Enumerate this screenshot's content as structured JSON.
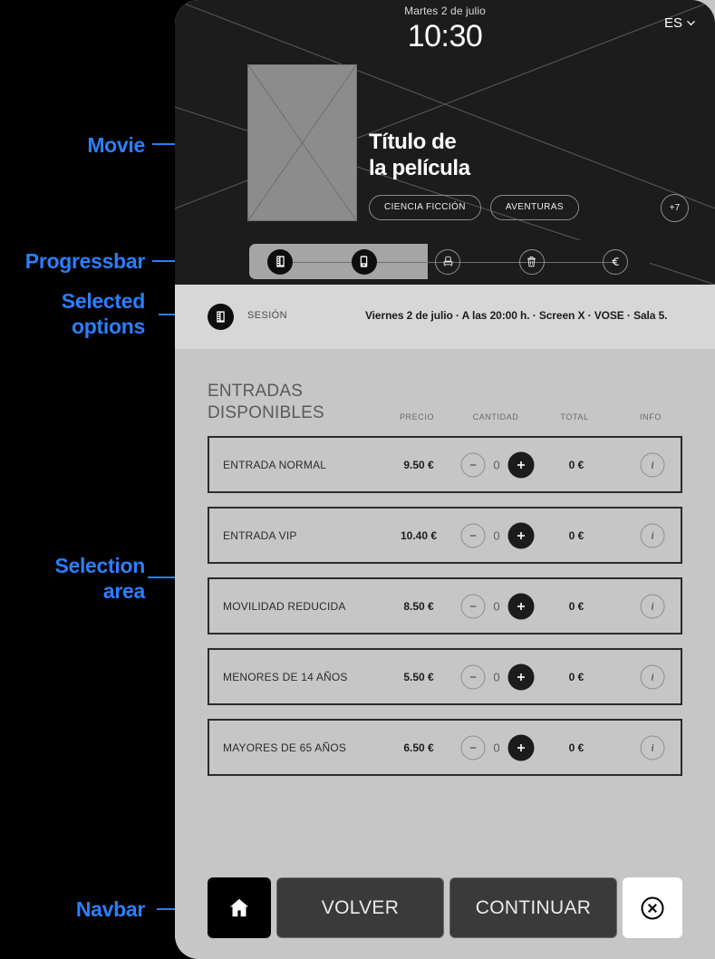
{
  "annotations": [
    {
      "id": "movie",
      "label": "Movie"
    },
    {
      "id": "progressbar",
      "label": "Progressbar"
    },
    {
      "id": "selected-options",
      "label": "Selected\noptions"
    },
    {
      "id": "selection-area",
      "label": "Selection\narea"
    },
    {
      "id": "navbar",
      "label": "Navbar"
    }
  ],
  "accent_color": "#2b7fff",
  "header": {
    "date": "Martes 2 de julio",
    "time": "10:30",
    "language": "ES",
    "language_chevron_icon": "chevron-down-icon"
  },
  "movie": {
    "poster_icon": "placeholder-image-icon",
    "title": "Título de\nla película",
    "tags": [
      "CIENCIA FICCIÓN",
      "AVENTURAS"
    ],
    "more_tags_badge": "+7"
  },
  "progressbar": {
    "fill_percent": 45,
    "steps": [
      {
        "icon": "film-strip-icon",
        "state": "done"
      },
      {
        "icon": "ticket-icon",
        "state": "done"
      },
      {
        "icon": "seat-icon",
        "state": "todo"
      },
      {
        "icon": "popcorn-icon",
        "state": "todo"
      },
      {
        "icon": "euro-icon",
        "state": "todo"
      }
    ]
  },
  "session": {
    "icon": "film-strip-icon",
    "label": "SESIÓN",
    "value": "Viernes 2 de julio · A las 20:00 h. · Screen X · VOSE · Sala 5."
  },
  "selection": {
    "title": "ENTRADAS\nDISPONIBLES",
    "columns": [
      "PRECIO",
      "CANTIDAD",
      "TOTAL",
      "INFO"
    ],
    "rows": [
      {
        "name": "ENTRADA NORMAL",
        "price": "9.50 €",
        "qty": "0",
        "total": "0 €",
        "info_icon": "info-icon"
      },
      {
        "name": "ENTRADA VIP",
        "price": "10.40 €",
        "qty": "0",
        "total": "0 €",
        "info_icon": "info-icon"
      },
      {
        "name": "MOVILIDAD REDUCIDA",
        "price": "8.50 €",
        "qty": "0",
        "total": "0 €",
        "info_icon": "info-icon"
      },
      {
        "name": "MENORES DE 14 AÑOS",
        "price": "5.50 €",
        "qty": "0",
        "total": "0 €",
        "info_icon": "info-icon"
      },
      {
        "name": "MAYORES DE 65 AÑOS",
        "price": "6.50 €",
        "qty": "0",
        "total": "0 €",
        "info_icon": "info-icon"
      }
    ],
    "decrease_icon": "minus-icon",
    "increase_icon": "plus-icon"
  },
  "navbar": {
    "home_icon": "home-icon",
    "back_label": "VOLVER",
    "continue_label": "CONTINUAR",
    "close_icon": "close-circle-icon"
  }
}
